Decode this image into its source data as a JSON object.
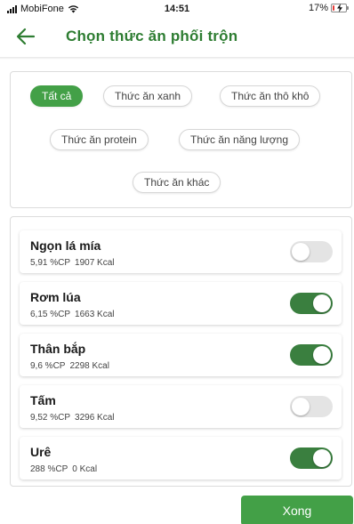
{
  "status_bar": {
    "carrier": "MobiFone",
    "time": "14:51",
    "battery_text": "17%",
    "battery_level": 0.17,
    "battery_color": "#e53935"
  },
  "header": {
    "title": "Chọn thức ăn phối trộn",
    "back_icon": "arrow-left-icon",
    "accent_color": "#2e7d32"
  },
  "filters": {
    "chips": [
      {
        "label": "Tất cả",
        "active": true
      },
      {
        "label": "Thức ăn xanh",
        "active": false
      },
      {
        "label": "Thức ăn thô khô",
        "active": false
      },
      {
        "label": "Thức ăn protein",
        "active": false
      },
      {
        "label": "Thức ăn năng lượng",
        "active": false
      },
      {
        "label": "Thức ăn khác",
        "active": false
      }
    ],
    "active_color": "#43a047"
  },
  "foods": [
    {
      "name": "Ngọn lá mía",
      "cp": "5,91 %CP",
      "kcal": "1907 Kcal",
      "selected": false
    },
    {
      "name": "Rơm lúa",
      "cp": "6,15 %CP",
      "kcal": "1663 Kcal",
      "selected": true
    },
    {
      "name": "Thân bắp",
      "cp": "9,6 %CP",
      "kcal": "2298 Kcal",
      "selected": true
    },
    {
      "name": "Tấm",
      "cp": "9,52 %CP",
      "kcal": "3296 Kcal",
      "selected": false
    },
    {
      "name": "Urê",
      "cp": "288 %CP",
      "kcal": "0 Kcal",
      "selected": true
    }
  ],
  "toggle_on_color": "#3a7f3f",
  "done_button": {
    "label": "Xong"
  }
}
